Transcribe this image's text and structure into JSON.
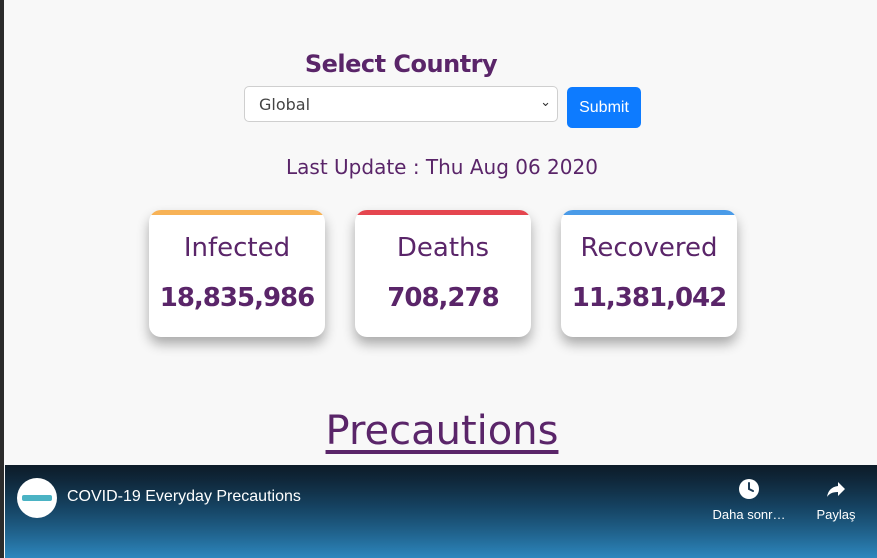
{
  "select": {
    "title": "Select Country",
    "selected": "Global",
    "submit_label": "Submit"
  },
  "last_update": "Last Update : Thu Aug 06 2020",
  "stats": {
    "infected": {
      "label": "Infected",
      "value": "18,835,986",
      "color": "#f7b256"
    },
    "deaths": {
      "label": "Deaths",
      "value": "708,278",
      "color": "#e5464f"
    },
    "recovered": {
      "label": "Recovered",
      "value": "11,381,042",
      "color": "#4a9be8"
    }
  },
  "precautions_heading": "Precautions",
  "video": {
    "title": "COVID-19 Everyday Precautions",
    "watch_later_label": "Daha sonr…",
    "share_label": "Paylaş",
    "watch_later_icon": "clock-icon",
    "share_icon": "share-arrow-icon"
  },
  "colors": {
    "accent": "#5a2569",
    "button": "#0d7bff"
  }
}
